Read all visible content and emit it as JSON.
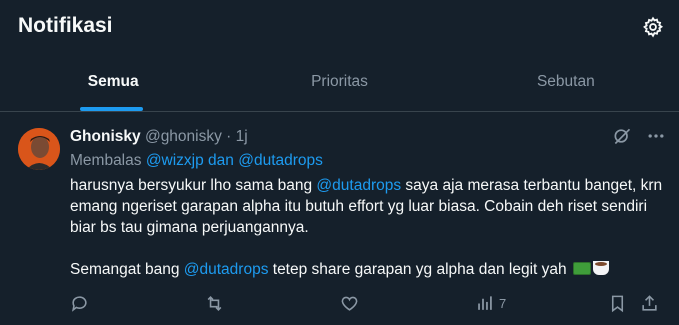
{
  "header": {
    "title": "Notifikasi",
    "settings_icon": "gear-icon"
  },
  "tabs": [
    {
      "label": "Semua",
      "active": true
    },
    {
      "label": "Prioritas",
      "active": false
    },
    {
      "label": "Sebutan",
      "active": false
    }
  ],
  "post": {
    "author_name": "Ghonisky",
    "author_handle": "@ghonisky",
    "separator": " · ",
    "time": "1j",
    "reply_prefix": "Membalas ",
    "reply_to": "@wizxjp dan @dutadrops",
    "body": {
      "p1_a": "harusnya bersyukur lho sama bang ",
      "p1_mention": "@dutadrops",
      "p1_b": " saya aja merasa terbantu banget, krn emang ngeriset garapan alpha itu butuh effort yg luar biasa. Cobain deh riset sendiri biar bs tau gimana perjuangannya.",
      "p2_a": "Semangat bang ",
      "p2_mention": "@dutadrops",
      "p2_b": " tetep share garapan yg alpha dan legit yah"
    },
    "stats": {
      "views": "7"
    }
  },
  "colors": {
    "background": "#15202b",
    "accent": "#1d9bf0",
    "muted": "#8b98a5",
    "text": "#f7f9f9"
  }
}
